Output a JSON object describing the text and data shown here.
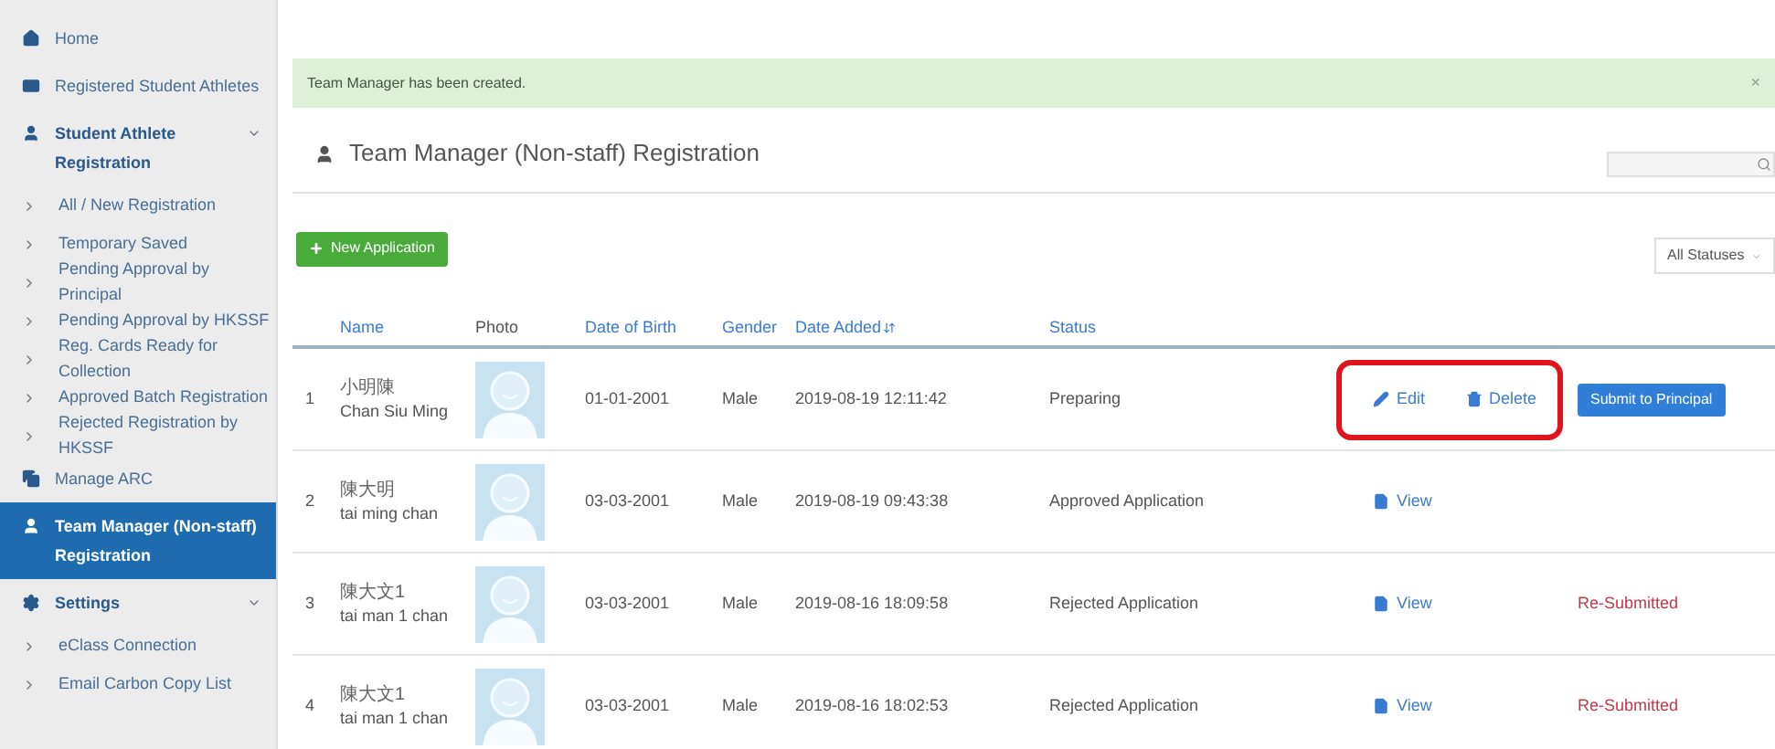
{
  "sidebar": {
    "items": [
      {
        "label": "Home",
        "kind": "top",
        "selected": false
      },
      {
        "label": "Registered Student Athletes",
        "kind": "top",
        "selected": false
      },
      {
        "label": "Student Athlete Registration",
        "kind": "section",
        "selected": false,
        "expanded": true
      },
      {
        "label": "All / New Registration",
        "kind": "sub",
        "selected": false
      },
      {
        "label": "Temporary Saved",
        "kind": "sub",
        "selected": false
      },
      {
        "label": "Pending Approval by Principal",
        "kind": "sub",
        "selected": false
      },
      {
        "label": "Pending Approval by HKSSF",
        "kind": "sub",
        "selected": false
      },
      {
        "label": "Reg. Cards Ready for Collection",
        "kind": "sub",
        "selected": false
      },
      {
        "label": "Approved Batch Registration",
        "kind": "sub",
        "selected": false
      },
      {
        "label": "Rejected Registration by HKSSF",
        "kind": "sub",
        "selected": false
      },
      {
        "label": "Manage ARC",
        "kind": "top",
        "selected": false
      },
      {
        "label": "Team Manager (Non-staff) Registration",
        "kind": "top",
        "selected": true
      },
      {
        "label": "Settings",
        "kind": "section",
        "selected": false,
        "expanded": true
      },
      {
        "label": "eClass Connection",
        "kind": "sub",
        "selected": false
      },
      {
        "label": "Email Carbon Copy List",
        "kind": "sub",
        "selected": false
      }
    ]
  },
  "alert": {
    "message": "Team Manager has been created.",
    "close": "×"
  },
  "page_title": "Team Manager (Non-staff) Registration",
  "new_button": "New Application",
  "status_filter": "All Statuses",
  "table": {
    "columns": [
      "Name",
      "Photo",
      "Date of Birth",
      "Gender",
      "Date Added",
      "Status"
    ],
    "rows": [
      {
        "index": "1",
        "name_zh": "小明陳",
        "name_en": "Chan Siu Ming",
        "dob": "01-01-2001",
        "gender": "Male",
        "added": "2019-08-19 12:11:42",
        "status": "Preparing",
        "highlighted": true,
        "actions": [
          {
            "kind": "edit",
            "label": "Edit"
          },
          {
            "kind": "delete",
            "label": "Delete"
          }
        ],
        "extra": {
          "kind": "button",
          "label": "Submit to Principal"
        }
      },
      {
        "index": "2",
        "name_zh": "陳大明",
        "name_en": "tai ming chan",
        "dob": "03-03-2001",
        "gender": "Male",
        "added": "2019-08-19 09:43:38",
        "status": "Approved Application",
        "highlighted": false,
        "actions": [
          {
            "kind": "view",
            "label": "View"
          }
        ]
      },
      {
        "index": "3",
        "name_zh": "陳大文1",
        "name_en": "tai man 1 chan",
        "dob": "03-03-2001",
        "gender": "Male",
        "added": "2019-08-16 18:09:58",
        "status": "Rejected Application",
        "highlighted": false,
        "actions": [
          {
            "kind": "view",
            "label": "View"
          }
        ],
        "extra": {
          "kind": "note",
          "label": "Re-Submitted"
        }
      },
      {
        "index": "4",
        "name_zh": "陳大文1",
        "name_en": "tai man 1 chan",
        "dob": "03-03-2001",
        "gender": "Male",
        "added": "2019-08-16 18:02:53",
        "status": "Rejected Application",
        "highlighted": false,
        "actions": [
          {
            "kind": "view",
            "label": "View"
          }
        ],
        "extra": {
          "kind": "note",
          "label": "Re-Submitted"
        }
      }
    ]
  }
}
